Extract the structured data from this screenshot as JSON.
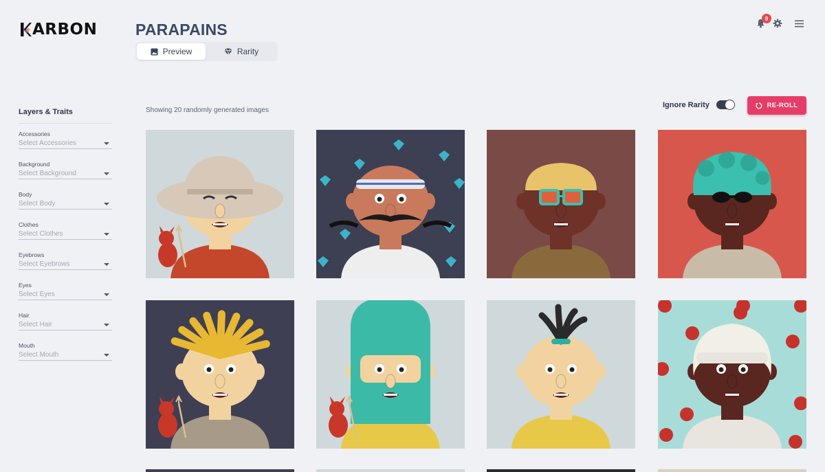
{
  "brand": {
    "logo_text": "ARBON"
  },
  "project": {
    "title": "PARAPAINS"
  },
  "tabs": [
    {
      "label": "Preview",
      "icon": "image-icon",
      "active": true
    },
    {
      "label": "Rarity",
      "icon": "diamond-icon",
      "active": false
    }
  ],
  "header": {
    "notification_count": "9",
    "icons": [
      "bell-icon",
      "gear-icon",
      "menu-icon"
    ]
  },
  "sidebar": {
    "title": "Layers & Traits",
    "fields": [
      {
        "label": "Accessories",
        "placeholder": "Select Accessories"
      },
      {
        "label": "Background",
        "placeholder": "Select Background"
      },
      {
        "label": "Body",
        "placeholder": "Select Body"
      },
      {
        "label": "Clothes",
        "placeholder": "Select Clothes"
      },
      {
        "label": "Eyebrows",
        "placeholder": "Select Eyebrows"
      },
      {
        "label": "Eyes",
        "placeholder": "Select Eyes"
      },
      {
        "label": "Hair",
        "placeholder": "Select Hair"
      },
      {
        "label": "Mouth",
        "placeholder": "Select Mouth"
      }
    ]
  },
  "main": {
    "showing_text": "Showing 20 randomly generated images",
    "ignore_rarity_label": "Ignore Rarity",
    "ignore_rarity_on": true,
    "reroll_label": "RE-ROLL"
  },
  "colors": {
    "accent": "#e53d68",
    "title": "#3a4a66",
    "badge": "#e64a4a"
  },
  "gallery": [
    {
      "bg": "#cfd8da",
      "skin": "#f2d3a0",
      "hair": "hat",
      "hair_color": "#d8c8b8",
      "shirt": "#c4472c",
      "eyes": "sleepy",
      "devil": true
    },
    {
      "bg": "#3d3f52",
      "skin": "#c97a5c",
      "hair": "headband",
      "hair_color": "#e8e8e8",
      "shirt": "#eeeeee",
      "eyes": "round",
      "devil": false
    },
    {
      "bg": "#7a4a47",
      "skin": "#6e3228",
      "hair": "glasses",
      "hair_color": "#e8c36a",
      "shirt": "#8a6a3c",
      "eyes": "glasses",
      "devil": false
    },
    {
      "bg": "#d8574c",
      "skin": "#5a2620",
      "hair": "curly",
      "hair_color": "#3bbfae",
      "shirt": "#c8bca8",
      "eyes": "shades",
      "devil": false
    },
    {
      "bg": "#3e3f52",
      "skin": "#f2d3a0",
      "hair": "spiky",
      "hair_color": "#e8b832",
      "shirt": "#a89a88",
      "eyes": "round",
      "devil": true
    },
    {
      "bg": "#cfd8da",
      "skin": "#f2d3a0",
      "hair": "tall",
      "hair_color": "#3cbaa8",
      "shirt": "#e8c848",
      "eyes": "round",
      "devil": true
    },
    {
      "bg": "#cfd8da",
      "skin": "#f2d3a0",
      "hair": "antenna",
      "hair_color": "#2a2a2a",
      "shirt": "#e8c848",
      "eyes": "round",
      "devil": false
    },
    {
      "bg": "#a8dcd8",
      "skin": "#5a2620",
      "hair": "fluffy",
      "hair_color": "#f2efe6",
      "shirt": "#e8e4de",
      "eyes": "round",
      "devil": false
    }
  ],
  "gallery_peek": [
    "#3e3f52",
    "#cfd8da",
    "#2a2b33",
    "#d8d0c4"
  ]
}
